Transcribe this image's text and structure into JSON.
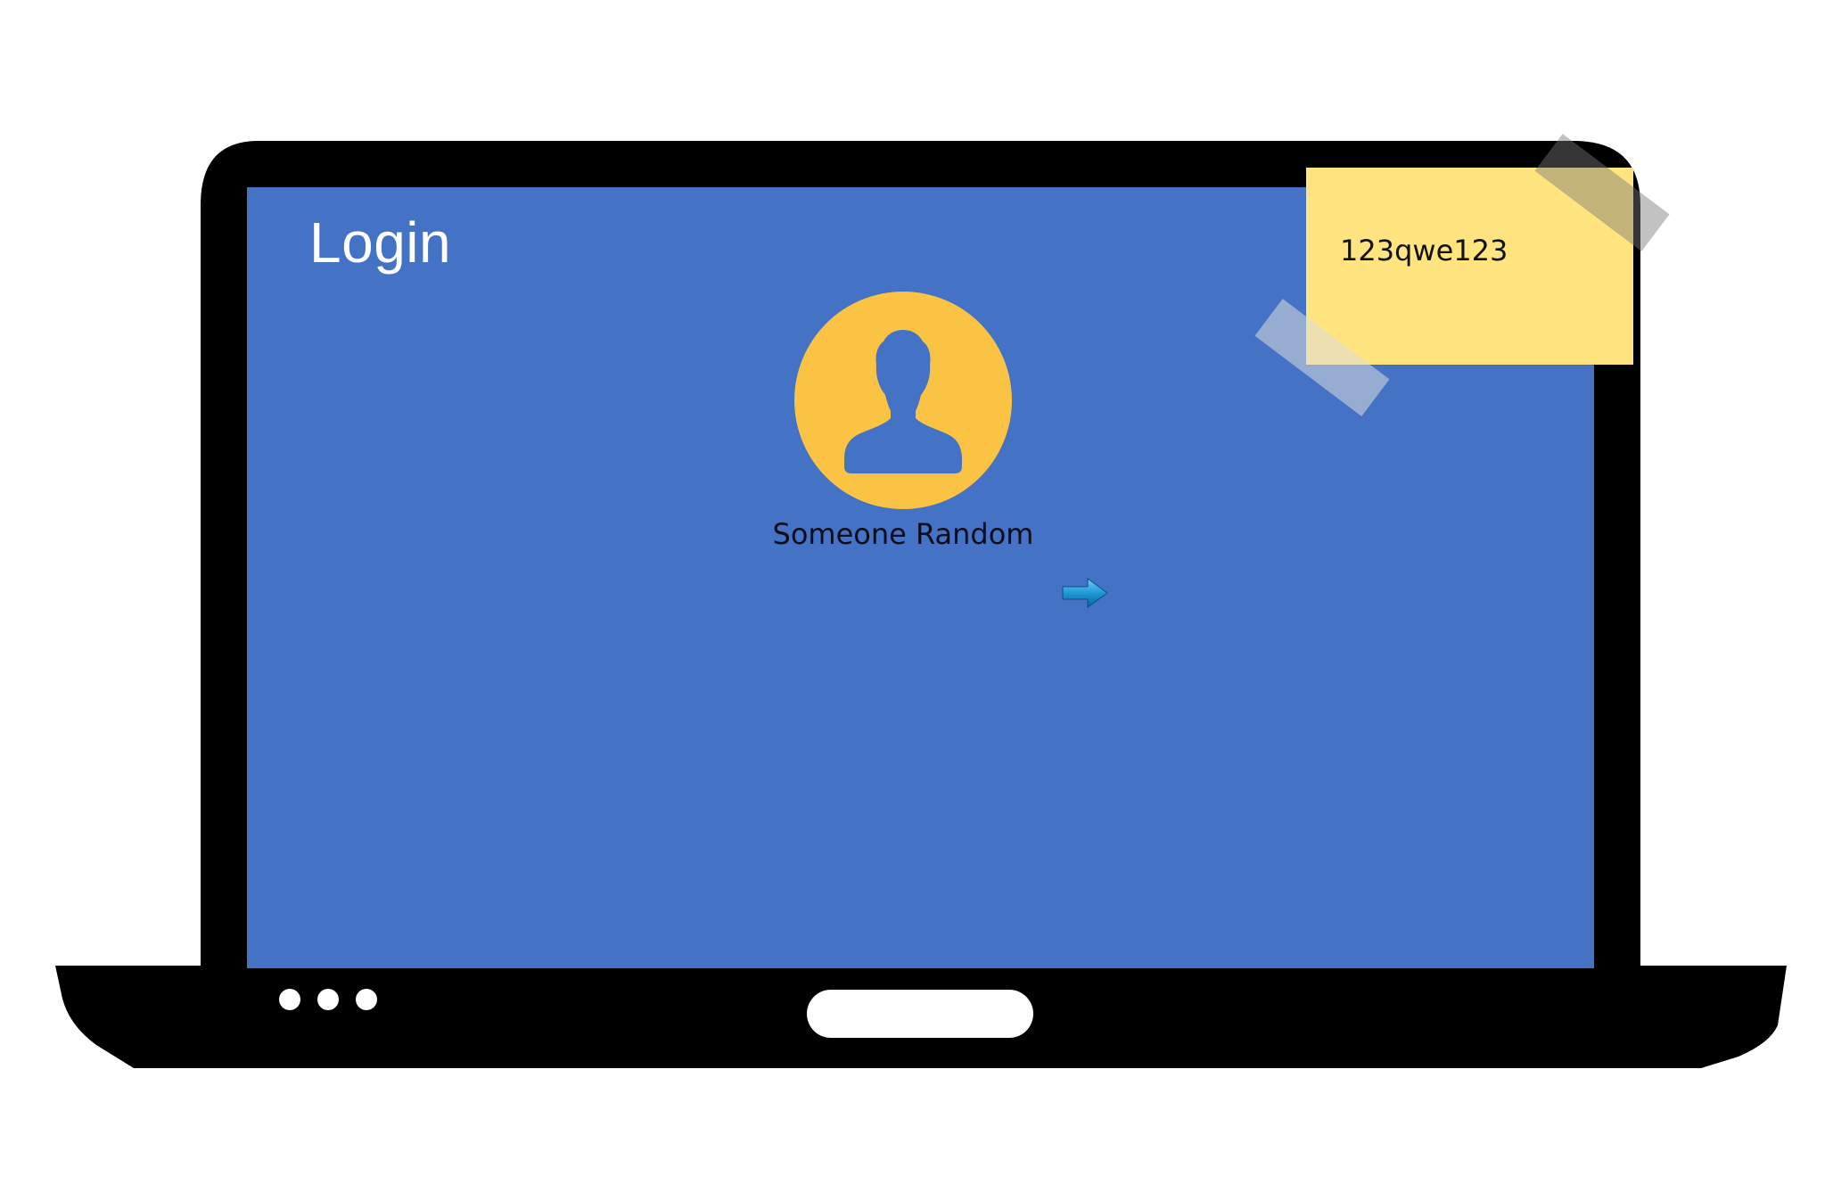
{
  "screen": {
    "title": "Login",
    "background_color": "#4472c4"
  },
  "user": {
    "name": "Someone Random",
    "avatar_icon": "user-silhouette-icon",
    "avatar_color": "#fbc344"
  },
  "submit": {
    "icon": "arrow-right-icon"
  },
  "sticky_note": {
    "text": "123qwe123",
    "color": "#ffe47f"
  },
  "laptop": {
    "frame_color": "#000000",
    "indicator_lights": 3
  }
}
